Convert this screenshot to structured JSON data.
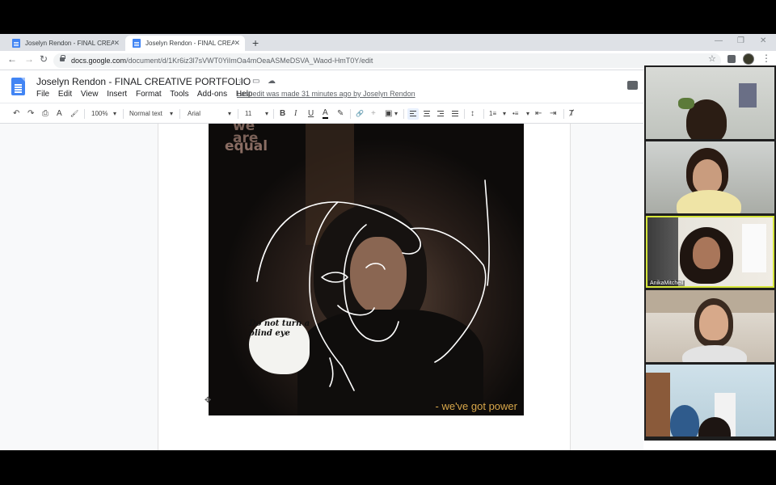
{
  "browser": {
    "tabs": [
      {
        "title": "Joselyn Rendon - FINAL CREATIV",
        "active": false
      },
      {
        "title": "Joselyn Rendon - FINAL CREATIV",
        "active": true
      }
    ],
    "new_tab": "+",
    "window_controls": {
      "minimize": "—",
      "maximize": "❐",
      "close": "✕"
    },
    "back": "←",
    "forward": "→",
    "reload": "↻",
    "url_host": "docs.google.com",
    "url_path": "/document/d/1Kr6iz3l7sVWT0YiImOa4mOeaASMeDSVA_Waod-HmT0Y/edit",
    "bookmark_star": "☆",
    "menu_dots": "⋮"
  },
  "docs": {
    "title": "Joselyn Rendon - FINAL CREATIVE PORTFOLIO",
    "title_icons": {
      "star": "☆",
      "move": "▭",
      "cloud": "☁"
    },
    "menu": [
      "File",
      "Edit",
      "View",
      "Insert",
      "Format",
      "Tools",
      "Add-ons",
      "Help"
    ],
    "last_edit": "Last edit was made 31 minutes ago by Joselyn Rendon"
  },
  "toolbar": {
    "undo": "↶",
    "redo": "↷",
    "print": "⎙",
    "spellcheck": "A",
    "paint_format": "🖌",
    "zoom": "100%",
    "style": "Normal text",
    "font": "Arial",
    "font_size": "11",
    "bold": "B",
    "italic": "I",
    "underline": "U",
    "text_color": "A",
    "highlight": "✎",
    "link": "🔗",
    "comment": "+",
    "image": "▣",
    "line_spacing": "↕",
    "numbered_list": "1≡",
    "bulleted_list": "•≡",
    "indent_less": "⇤",
    "indent_more": "⇥",
    "clear_format": "Ⱦ",
    "dropdown": "▾"
  },
  "artwork": {
    "text_top_1": "we",
    "text_top_2": "are",
    "text_top_3": "equal",
    "text_blob": "Do not turn a blind eye",
    "caption": "- we've got power"
  },
  "video_call": {
    "participants": [
      {
        "name": "",
        "speaking": false
      },
      {
        "name": "",
        "speaking": false
      },
      {
        "name": "AnikaMitchell",
        "speaking": true
      },
      {
        "name": "",
        "speaking": false
      },
      {
        "name": "",
        "speaking": false
      }
    ]
  },
  "colors": {
    "docs_blue": "#4285f4",
    "speaker_highlight": "#d6e63a",
    "caption": "#d8a74a"
  }
}
